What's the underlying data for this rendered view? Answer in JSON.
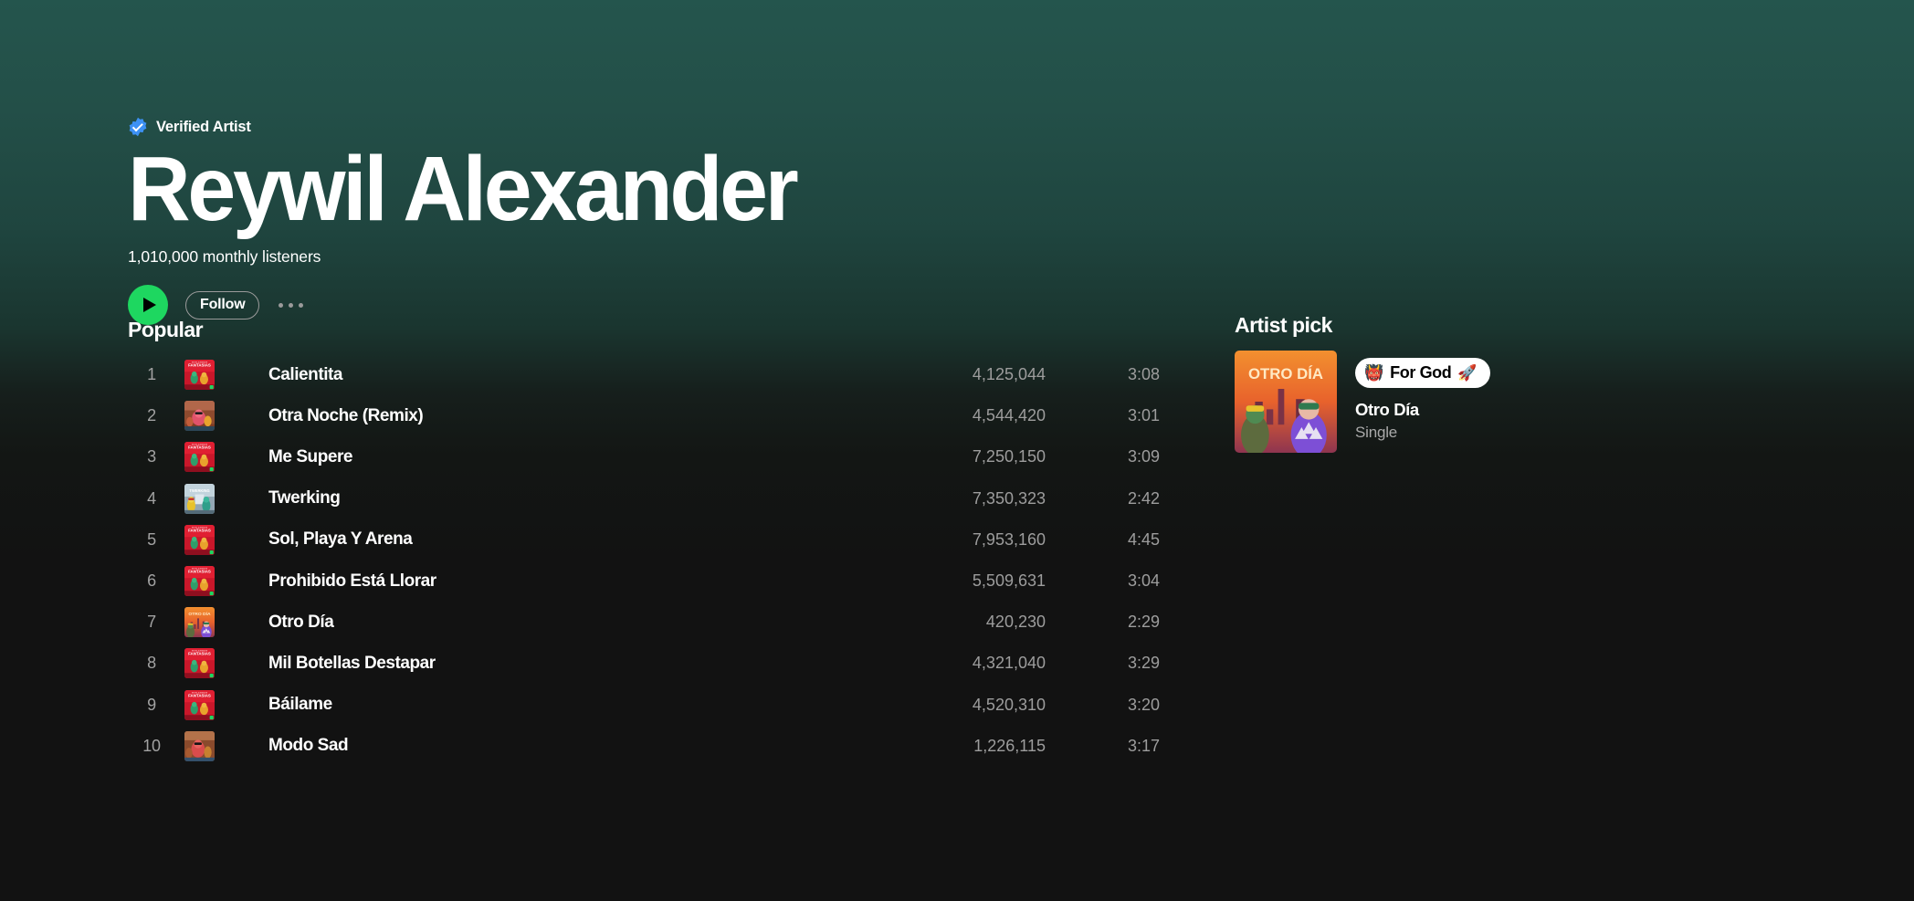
{
  "theme": {
    "accent_green": "#1ed760",
    "verified_blue": "#3d91f4",
    "background_top": "#24554d",
    "background_bottom": "#121212",
    "text_primary": "#ffffff",
    "text_secondary": "#a2a2a2"
  },
  "header": {
    "verified_label": "Verified Artist",
    "artist_name": "Reywil Alexander",
    "monthly_listeners": "1,010,000 monthly listeners",
    "follow_label": "Follow",
    "play_label": "Play",
    "more_label": "More options"
  },
  "popular": {
    "title": "Popular",
    "tracks": [
      {
        "index": "1",
        "title": "Calientita",
        "plays": "4,125,044",
        "duration": "3:08",
        "art": "fantasias"
      },
      {
        "index": "2",
        "title": "Otra Noche (Remix)",
        "plays": "4,544,420",
        "duration": "3:01",
        "art": "otranoche"
      },
      {
        "index": "3",
        "title": "Me Supere",
        "plays": "7,250,150",
        "duration": "3:09",
        "art": "fantasias"
      },
      {
        "index": "4",
        "title": "Twerking",
        "plays": "7,350,323",
        "duration": "2:42",
        "art": "twerking"
      },
      {
        "index": "5",
        "title": "Sol, Playa Y Arena",
        "plays": "7,953,160",
        "duration": "4:45",
        "art": "fantasias"
      },
      {
        "index": "6",
        "title": "Prohibido Está Llorar",
        "plays": "5,509,631",
        "duration": "3:04",
        "art": "fantasias"
      },
      {
        "index": "7",
        "title": "Otro Día",
        "plays": "420,230",
        "duration": "2:29",
        "art": "otrodia"
      },
      {
        "index": "8",
        "title": "Mil Botellas Destapar",
        "plays": "4,321,040",
        "duration": "3:29",
        "art": "fantasias"
      },
      {
        "index": "9",
        "title": "Báilame",
        "plays": "4,520,310",
        "duration": "3:20",
        "art": "fantasias"
      },
      {
        "index": "10",
        "title": "Modo Sad",
        "plays": "1,226,115",
        "duration": "3:17",
        "art": "modosad"
      }
    ]
  },
  "artist_pick": {
    "title": "Artist pick",
    "note_text": "For God",
    "note_emoji_left": "👹",
    "note_emoji_right": "🚀",
    "item_name": "Otro Día",
    "item_type": "Single",
    "cover_title": "OTRO DÍA"
  }
}
